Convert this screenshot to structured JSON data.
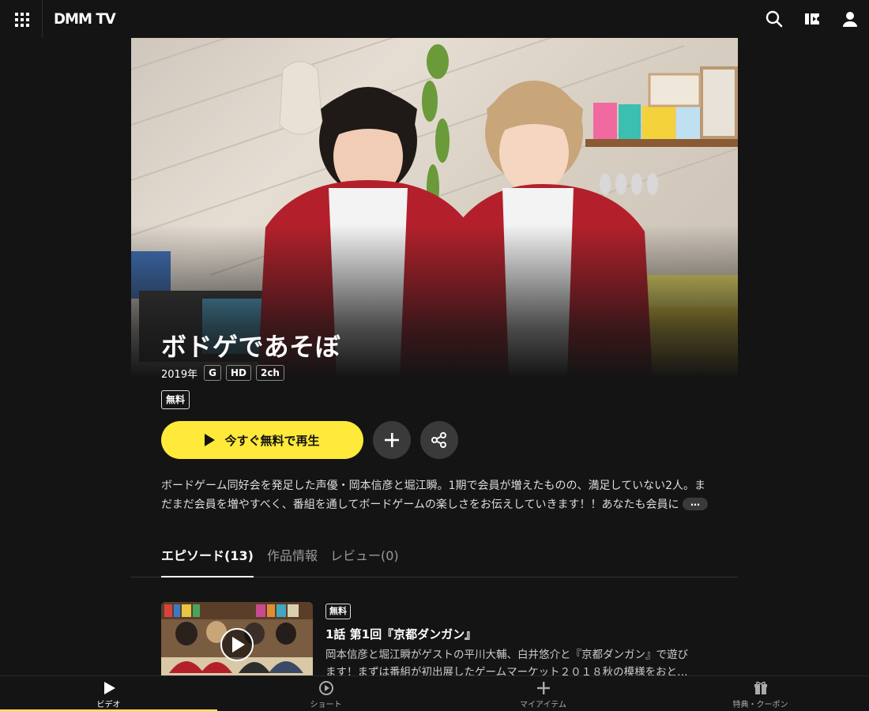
{
  "header": {
    "logo_text": "DMM TV",
    "icons": [
      "apps-grid-icon",
      "search-icon",
      "ticket-icon",
      "user-icon"
    ]
  },
  "title": {
    "name": "ボドゲであそぼ",
    "year": "2019年",
    "badges": [
      "G",
      "HD",
      "2ch"
    ],
    "free_label": "無料"
  },
  "actions": {
    "play_label": "今すぐ無料で再生",
    "add_icon": "plus-icon",
    "share_icon": "share-icon",
    "play_color": "#ffe93b"
  },
  "description": {
    "line1": "ボードゲーム同好会を発足した声優・岡本信彦と堀江瞬。1期で会員が増えたものの、満足していない2人。ま",
    "line2": "だまだ会員を増やすべく、番組を通してボードゲームの楽しさをお伝えしていきます！！あなたも会員に",
    "more_label": "…"
  },
  "tabs": [
    {
      "label": "エピソード(13)",
      "active": true
    },
    {
      "label": "作品情報",
      "active": false
    },
    {
      "label": "レビュー(0)",
      "active": false
    }
  ],
  "episodes": [
    {
      "free_label": "無料",
      "title": "1話 第1回『京都ダンガン』",
      "desc_line1": "岡本信彦と堀江瞬がゲストの平川大輔、白井悠介と『京都ダンガン』で遊び",
      "desc_line2": "ます！まずは番組が初出展したゲームマーケット２０１８秋の模様をおと…"
    }
  ],
  "bottom_nav": [
    {
      "label": "ビデオ",
      "icon": "play-icon",
      "active": true
    },
    {
      "label": "ショート",
      "icon": "short-video-icon",
      "active": false
    },
    {
      "label": "マイアイテム",
      "icon": "plus-icon",
      "active": false
    },
    {
      "label": "特典・クーポン",
      "icon": "gift-icon",
      "active": false
    }
  ]
}
